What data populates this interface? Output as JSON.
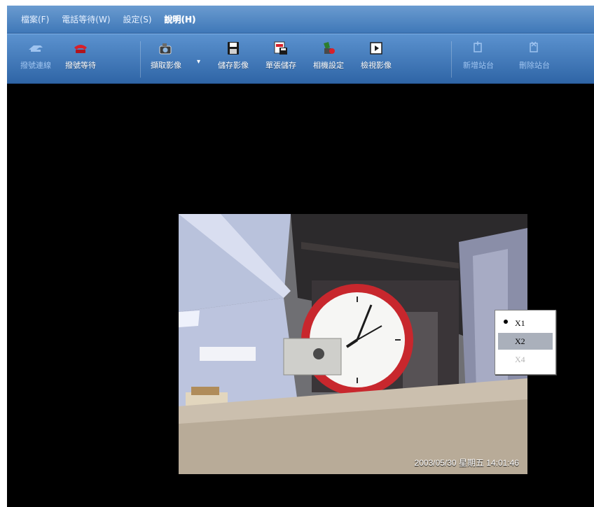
{
  "menubar": {
    "items": [
      {
        "label": "檔案(F)"
      },
      {
        "label": "電話等待(W)"
      },
      {
        "label": "設定(S)"
      },
      {
        "label": "說明(H)"
      }
    ]
  },
  "toolbar": {
    "buttons": [
      {
        "label": "撥號連線",
        "icon": "phone-dial-icon",
        "enabled": false
      },
      {
        "label": "撥號等待",
        "icon": "telephone-icon",
        "enabled": true
      },
      {
        "label": "擷取影像",
        "icon": "camera-icon",
        "enabled": true
      },
      {
        "label": "儲存影像",
        "icon": "floppy-disk-icon",
        "enabled": true
      },
      {
        "label": "單張儲存",
        "icon": "single-save-icon",
        "enabled": true
      },
      {
        "label": "相機設定",
        "icon": "camera-settings-icon",
        "enabled": true
      },
      {
        "label": "檢視影像",
        "icon": "play-view-icon",
        "enabled": true
      },
      {
        "label": "新增站台",
        "icon": "add-station-icon",
        "enabled": false
      },
      {
        "label": "刪除站台",
        "icon": "delete-station-icon",
        "enabled": false
      }
    ]
  },
  "video": {
    "timestamp": "2003/05/30 星期五 14:01:46"
  },
  "context_menu": {
    "items": [
      {
        "label": "X1",
        "selected": true,
        "enabled": true
      },
      {
        "label": "X2",
        "selected": false,
        "enabled": true
      },
      {
        "label": "X4",
        "selected": false,
        "enabled": false
      }
    ]
  },
  "colors": {
    "menubar": "#3f78b8",
    "toolbar": "#2f65a6",
    "background": "#000000",
    "clock_rim": "#c8272d",
    "highlight": "#aab0bb"
  }
}
